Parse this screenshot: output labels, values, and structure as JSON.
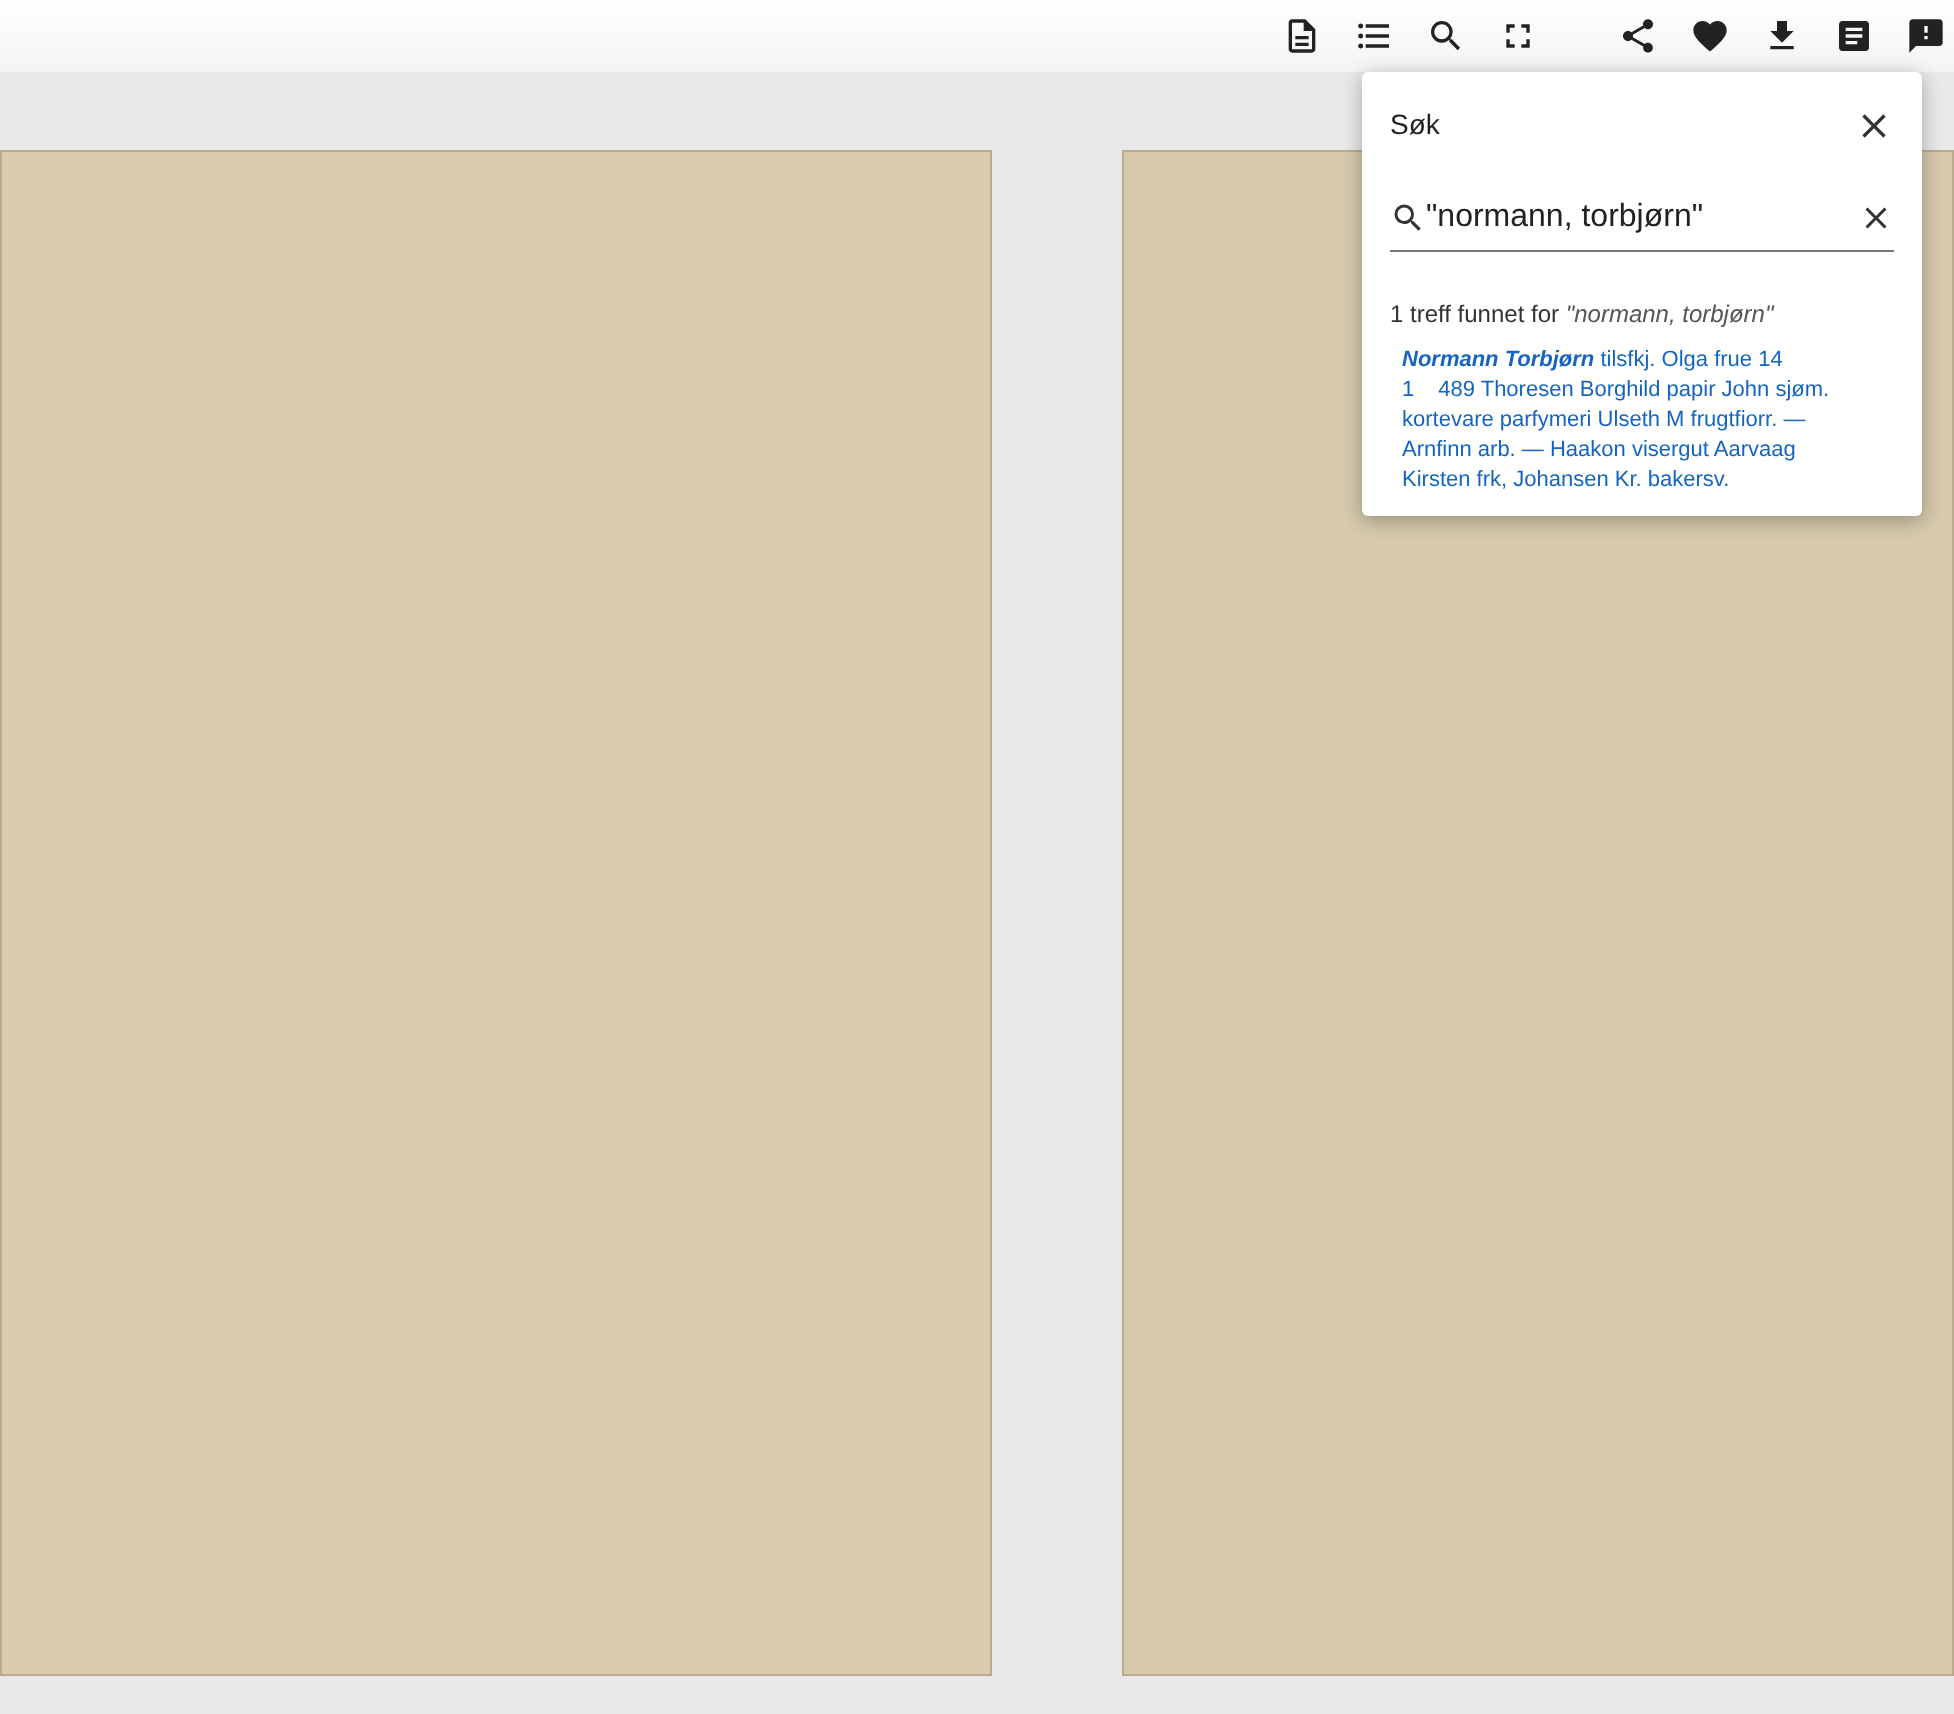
{
  "search_panel": {
    "title": "Søk",
    "query": "\"normann, torbjørn\"",
    "summary_count": "1 treff funnet for",
    "summary_query": "\"normann, torbjørn\"",
    "results": [
      {
        "hit": "Normann Torbjørn",
        "text": "tilsfkj. Olga frue 14 1",
        "page": "489",
        "snippet": "Thoresen Borghild papir John sjøm. kortevare parfymeri Ulseth M frugtfiorr. — Arnfinn arb. — Haakon visergut Aarvaag Kirsten frk, Johansen Kr. bakersv."
      }
    ]
  }
}
